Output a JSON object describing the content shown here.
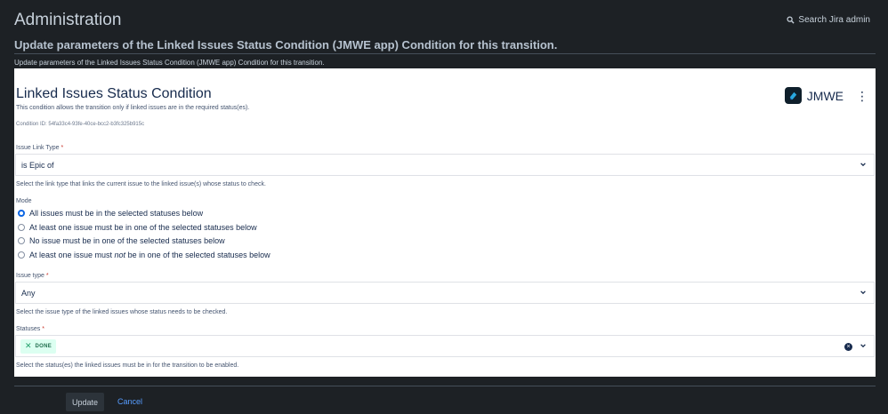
{
  "header": {
    "title": "Administration",
    "search_label": "Search Jira admin"
  },
  "page": {
    "heading": "Update parameters of the Linked Issues Status Condition (JMWE app) Condition for this transition.",
    "sub_description": "Update parameters of the Linked Issues Status Condition (JMWE app) Condition for this transition."
  },
  "panel": {
    "title": "Linked Issues Status Condition",
    "description": "This condition allows the transition only if linked issues are in the required status(es).",
    "condition_id": "Condition ID: 54fa33c4-93fe-40ce-bcc2-b3fc325b915c",
    "brand": "JMWE"
  },
  "issue_link_type": {
    "label": "Issue Link Type",
    "required_mark": "*",
    "value": "is Epic of",
    "help": "Select the link type that links the current issue to the linked issue(s) whose status to check."
  },
  "mode": {
    "label": "Mode",
    "options": [
      {
        "label": "All issues must be in the selected statuses below",
        "selected": true
      },
      {
        "label": "At least one issue must be in one of the selected statuses below",
        "selected": false
      },
      {
        "label": "No issue must be in one of the selected statuses below",
        "selected": false
      },
      {
        "label_before": "At least one issue must ",
        "label_em": "not",
        "label_after": " be in one of the selected statuses below",
        "selected": false
      }
    ]
  },
  "issue_type": {
    "label": "Issue type",
    "required_mark": "*",
    "value": "Any",
    "help": "Select the issue type of the linked issues whose status needs to be checked."
  },
  "statuses": {
    "label": "Statuses",
    "required_mark": "*",
    "tags": [
      "DONE"
    ],
    "help": "Select the status(es) the linked issues must be in for the transition to be enabled."
  },
  "footer": {
    "update_label": "Update",
    "cancel_label": "Cancel"
  },
  "colors": {
    "background": "#1d2125",
    "panel": "#ffffff",
    "accent": "#0c66e4",
    "link": "#579dff",
    "tag_bg": "#dcfff1",
    "tag_text": "#216e4e"
  }
}
